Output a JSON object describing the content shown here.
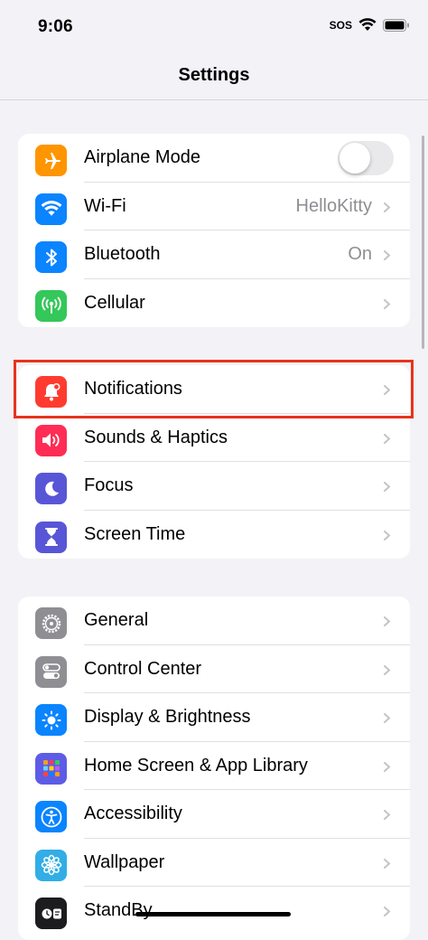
{
  "status": {
    "time": "9:06",
    "sos": "SOS"
  },
  "nav": {
    "title": "Settings"
  },
  "groups": [
    [
      {
        "label": "Airplane Mode",
        "icon": "airplane-icon",
        "color": "#ff9500",
        "toggle": false
      },
      {
        "label": "Wi-Fi",
        "icon": "wifi-icon",
        "color": "#0a84ff",
        "value": "HelloKitty"
      },
      {
        "label": "Bluetooth",
        "icon": "bluetooth-icon",
        "color": "#0a84ff",
        "value": "On"
      },
      {
        "label": "Cellular",
        "icon": "cellular-icon",
        "color": "#34c759"
      }
    ],
    [
      {
        "label": "Notifications",
        "icon": "notification-bell-icon",
        "color": "#ff3b30"
      },
      {
        "label": "Sounds & Haptics",
        "icon": "speaker-icon",
        "color": "#ff2d55"
      },
      {
        "label": "Focus",
        "icon": "moon-icon",
        "color": "#5856d6"
      },
      {
        "label": "Screen Time",
        "icon": "hourglass-icon",
        "color": "#5856d6"
      }
    ],
    [
      {
        "label": "General",
        "icon": "gear-icon",
        "color": "#8e8e93"
      },
      {
        "label": "Control Center",
        "icon": "toggles-icon",
        "color": "#8e8e93"
      },
      {
        "label": "Display & Brightness",
        "icon": "sun-icon",
        "color": "#0a84ff"
      },
      {
        "label": "Home Screen & App Library",
        "icon": "app-grid-icon",
        "color": "#5e5ce6"
      },
      {
        "label": "Accessibility",
        "icon": "accessibility-icon",
        "color": "#0a84ff"
      },
      {
        "label": "Wallpaper",
        "icon": "flower-icon",
        "color": "#32ade6"
      },
      {
        "label": "StandBy",
        "icon": "standby-icon",
        "color": "#1c1c1e"
      }
    ]
  ]
}
